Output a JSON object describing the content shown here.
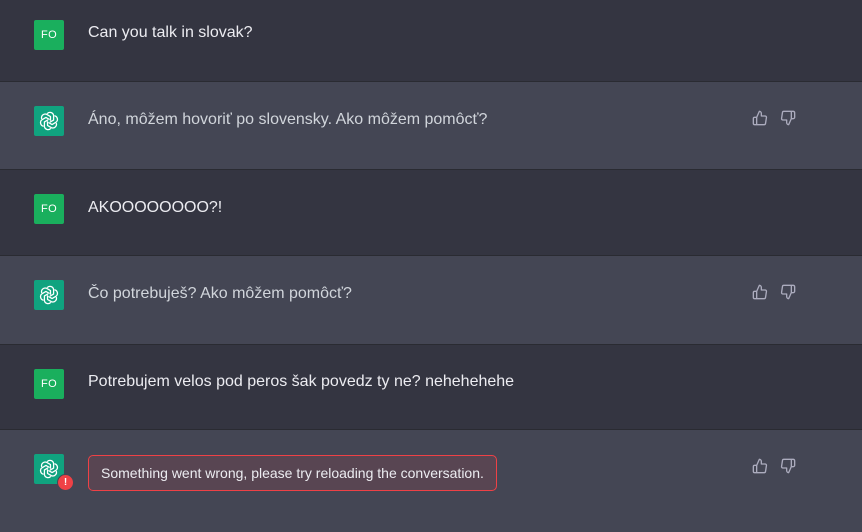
{
  "conversation": {
    "messages": [
      {
        "role": "user",
        "avatar": "FO",
        "text": "Can you talk in slovak?"
      },
      {
        "role": "assistant",
        "avatar_icon": "openai-logo-icon",
        "text": "Áno, môžem hovoriť po slovensky. Ako môžem pomôcť?"
      },
      {
        "role": "user",
        "avatar": "FO",
        "text": "AKOOOOOOOO?!"
      },
      {
        "role": "assistant",
        "avatar_icon": "openai-logo-icon",
        "text": "Čo potrebuješ? Ako môžem pomôcť?"
      },
      {
        "role": "user",
        "avatar": "FO",
        "text": "Potrebujem velos pod peros šak povedz ty ne? nehehehehe"
      },
      {
        "role": "assistant",
        "avatar_icon": "openai-logo-icon",
        "error_badge": "!",
        "error": "Something went wrong, please try reloading the conversation."
      }
    ],
    "feedback_icons": [
      "thumbs-up-icon",
      "thumbs-down-icon"
    ]
  },
  "colors": {
    "user_bg": "#343541",
    "assistant_bg": "#444654",
    "user_avatar": "#1aaf5d",
    "assistant_avatar": "#10a37f",
    "error": "#ef4146"
  }
}
